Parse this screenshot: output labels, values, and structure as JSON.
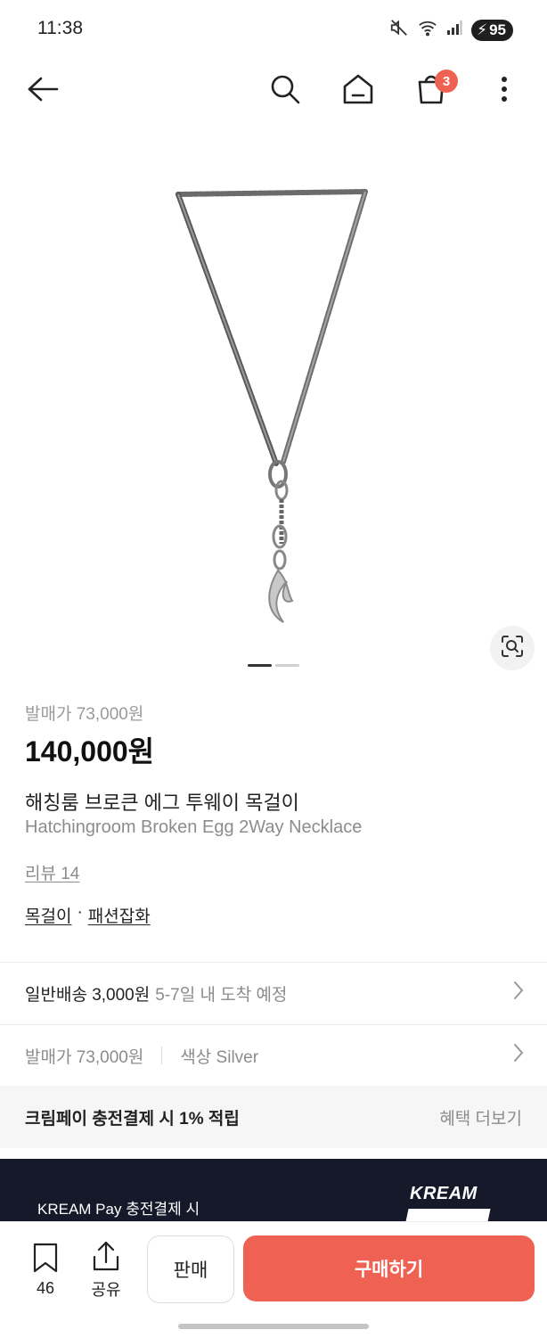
{
  "status_bar": {
    "time": "11:38",
    "battery": "95"
  },
  "nav": {
    "cart_count": "3"
  },
  "carousel": {
    "pages": 2,
    "active": 1
  },
  "product": {
    "release_price": "발매가 73,000원",
    "price": "140,000원",
    "title_ko": "해칭룸 브로큰 에그 투웨이 목걸이",
    "title_en": "Hatchingroom Broken Egg 2Way Necklace",
    "review": "리뷰 14",
    "category": "목걸이",
    "separator": "·",
    "subcategory": "패션잡화"
  },
  "shipping": {
    "label": "일반배송 3,000원",
    "eta": "5-7일 내 도착 예정"
  },
  "options": {
    "release": "발매가 73,000원",
    "color": "색상 Silver"
  },
  "benefit": {
    "text": "크림페이 충전결제 시 1% 적립",
    "more": "혜택 더보기"
  },
  "banner": {
    "text": "KREAM Pay 충전결제 시",
    "logo": "KREAM"
  },
  "bottom_bar": {
    "bookmark_count": "46",
    "share_label": "공유",
    "sell_label": "판매",
    "buy_label": "구매하기"
  }
}
